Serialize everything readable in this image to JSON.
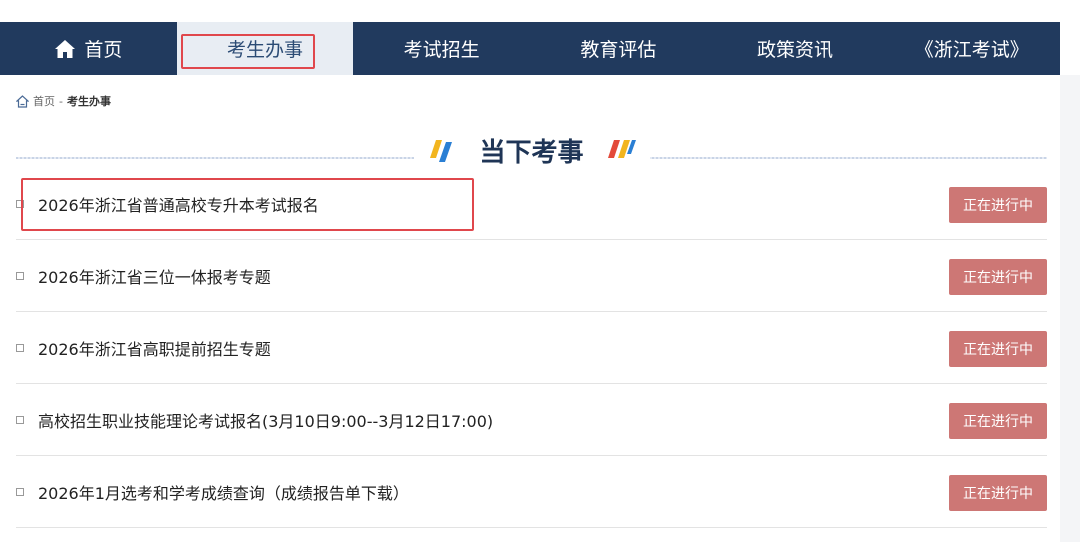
{
  "nav": {
    "home": "首页",
    "items": [
      "考生办事",
      "考试招生",
      "教育评估",
      "政策资讯",
      "《浙江考试》"
    ]
  },
  "breadcrumb": {
    "home": "首页",
    "separator": "-",
    "current": "考生办事"
  },
  "section": {
    "title": "当下考事"
  },
  "list": {
    "items": [
      {
        "title": "2026年浙江省普通高校专升本考试报名",
        "status": "正在进行中"
      },
      {
        "title": "2026年浙江省三位一体报考专题",
        "status": "正在进行中"
      },
      {
        "title": "2026年浙江省高职提前招生专题",
        "status": "正在进行中"
      },
      {
        "title": "高校招生职业技能理论考试报名(3月10日9:00--3月12日17:00)",
        "status": "正在进行中"
      },
      {
        "title": "2026年1月选考和学考成绩查询（成绩报告单下载）",
        "status": "正在进行中"
      }
    ]
  },
  "colors": {
    "nav_bg": "#213a5e",
    "nav_active_bg": "#e8edf3",
    "status_bg": "#cd7775",
    "highlight": "#e0474c"
  },
  "icons": {
    "home": "home-icon",
    "breadcrumb_home": "home-outline-icon",
    "deco": "slash-stripes-icon"
  }
}
